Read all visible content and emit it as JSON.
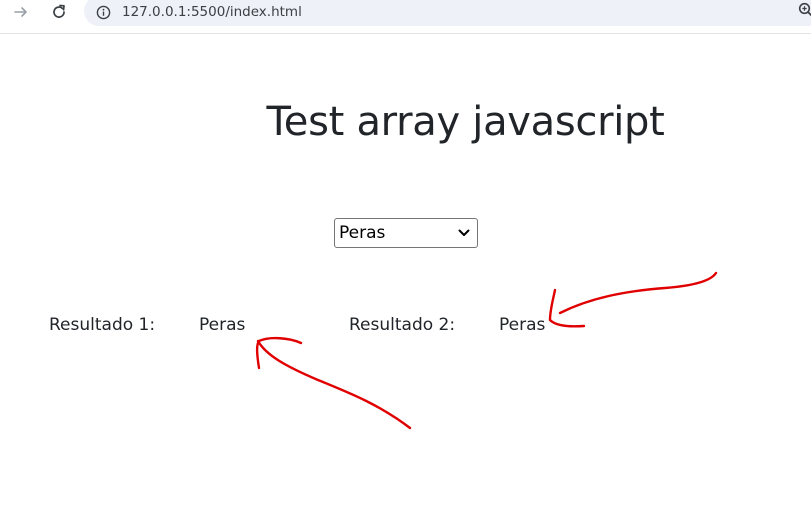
{
  "browser": {
    "url": "127.0.0.1:5500/index.html",
    "icons": {
      "forward": "arrow-forward-icon",
      "reload": "reload-icon",
      "site_info": "info-icon",
      "zoom": "zoom-icon"
    }
  },
  "page": {
    "title": "Test array javascript",
    "select": {
      "selected": "Peras",
      "options": [
        "Peras"
      ]
    },
    "results": [
      {
        "label": "Resultado 1:",
        "value": "Peras"
      },
      {
        "label": "Resultado 2:",
        "value": "Peras"
      }
    ]
  },
  "annotations": {
    "color": "#e00000",
    "marks": [
      "arrow-to-resultado-1",
      "arrow-to-resultado-2"
    ]
  }
}
